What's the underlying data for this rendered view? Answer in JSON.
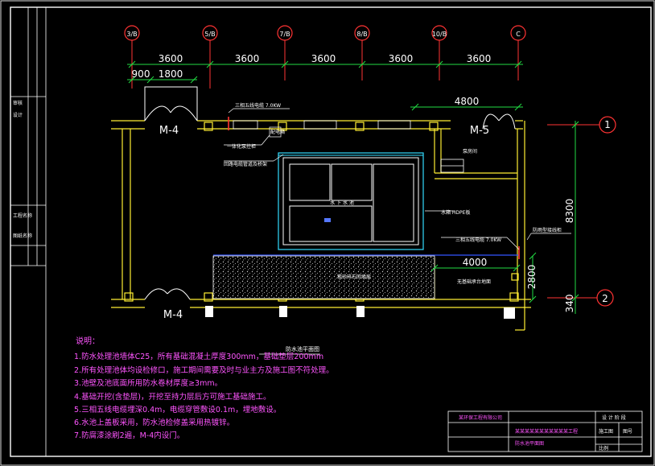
{
  "axes_top": [
    "3/B",
    "5/B",
    "7/B",
    "8/B",
    "10/B",
    "C"
  ],
  "axes_right": [
    "1",
    "2"
  ],
  "dims_top": [
    "3600",
    "3600",
    "3600",
    "3600",
    "3600"
  ],
  "dims_sub": [
    "900",
    "1800"
  ],
  "dim_4800": "4800",
  "dim_8300": "8300",
  "dim_4000": "4000",
  "dim_2800": "2800",
  "dim_340": "340",
  "door_labels": [
    "M-4",
    "M-5",
    "M-4"
  ],
  "room_labels": {
    "pump": "泵房间",
    "center": "水 下 水 池",
    "gravel": "粗砂碎石回填层",
    "right_room": "无基础承台地面",
    "bottom": "防水池平面图"
  },
  "leaders": [
    "三相五线电缆 7.0KW",
    "配电箱",
    "一体化泵控柜",
    "回路电缆管道及桥架",
    "水箱 HDPE板",
    "三相五线电缆 7.0KW",
    "防雨型接线柜"
  ],
  "notes_title": "说明：",
  "notes": [
    "1.防水处理池墙体C25，所有基础混凝土厚度300mm，基础垫层200mm",
    "2.所有处理池体均设检修口，施工期间需要及时与业主方及施工图不符处理。",
    "3.池壁及池底面所用防水卷材厚度≥3mm。",
    "4.基础开挖(含垫层)，开挖至持力层后方可施工基础施工。",
    "5.三相五线电缆埋深0.4m，电缆穿管敷设0.1m，埋地敷设。",
    "6.水池上盖板采用，防水池检修盖采用热镀锌。",
    "7.防腐漆涂刷2遍，M-4内设门。"
  ],
  "title_block": {
    "row1": "某环保工程有限公司",
    "row2": "某某某某某某某某某某某工程",
    "row3": "防水池平面图",
    "col1": "设 计 阶 段",
    "col2": "施工图",
    "col3": "图号",
    "col4": "比例"
  },
  "side_labels": [
    "审核",
    "设计",
    "工程名称",
    "图纸名称"
  ]
}
